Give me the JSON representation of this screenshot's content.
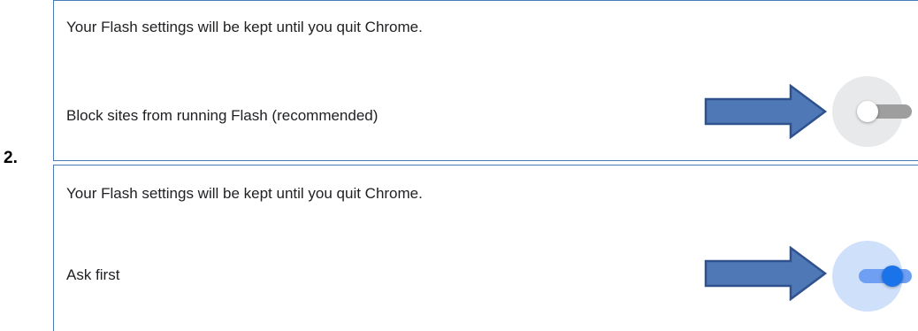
{
  "step_label": "2.",
  "panels": [
    {
      "info": "Your Flash settings will be kept until you quit Chrome.",
      "setting": "Block sites from running Flash (recommended)",
      "toggle_state": "off"
    },
    {
      "info": "Your Flash settings will be kept until you quit Chrome.",
      "setting": "Ask first",
      "toggle_state": "on"
    }
  ],
  "colors": {
    "arrow_fill": "#4f79b6",
    "arrow_stroke": "#2f528f",
    "panel_border": "#4a7ab8",
    "toggle_on": "#1a73e8",
    "toggle_off_track": "#9e9e9e"
  },
  "icons": {
    "annotation_arrow": "right-arrow-icon"
  }
}
